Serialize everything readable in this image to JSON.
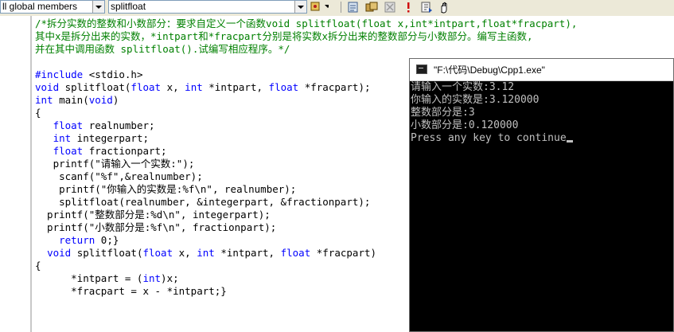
{
  "toolbar": {
    "members_combo": "ll global members",
    "function_combo": "splitfloat",
    "icons": [
      "class-wizard-icon",
      "add-member-icon",
      "toggle-icon",
      "build-stop-icon",
      "build-icon",
      "go-icon",
      "breakpoint-icon"
    ]
  },
  "editor": {
    "lines": [
      [
        {
          "t": "/*拆分实数的整数和小数部分：要求自定义一个函数void splitfloat(float x,int*intpart,float*fracpart),",
          "c": "cmt"
        }
      ],
      [
        {
          "t": "其中x是拆分出来的实数，*intpart和*fracpart分别是将实数x拆分出来的整数部分与小数部分。编写主函数,",
          "c": "cmt"
        }
      ],
      [
        {
          "t": "并在其中调用函数 splitfloat().试编写相应程序。*/",
          "c": "cmt"
        }
      ],
      [
        {
          "t": "",
          "c": ""
        }
      ],
      [
        {
          "t": "#include",
          "c": "pp"
        },
        {
          "t": " <stdio.h>",
          "c": ""
        }
      ],
      [
        {
          "t": "void",
          "c": "kw"
        },
        {
          "t": " splitfloat(",
          "c": ""
        },
        {
          "t": "float",
          "c": "kw"
        },
        {
          "t": " x, ",
          "c": ""
        },
        {
          "t": "int",
          "c": "kw"
        },
        {
          "t": " *intpart, ",
          "c": ""
        },
        {
          "t": "float",
          "c": "kw"
        },
        {
          "t": " *fracpart);",
          "c": ""
        }
      ],
      [
        {
          "t": "int",
          "c": "kw"
        },
        {
          "t": " main(",
          "c": ""
        },
        {
          "t": "void",
          "c": "kw"
        },
        {
          "t": ")",
          "c": ""
        }
      ],
      [
        {
          "t": "{",
          "c": ""
        }
      ],
      [
        {
          "t": "   ",
          "c": ""
        },
        {
          "t": "float",
          "c": "kw"
        },
        {
          "t": " realnumber;",
          "c": ""
        }
      ],
      [
        {
          "t": "   ",
          "c": ""
        },
        {
          "t": "int",
          "c": "kw"
        },
        {
          "t": " integerpart;",
          "c": ""
        }
      ],
      [
        {
          "t": "   ",
          "c": ""
        },
        {
          "t": "float",
          "c": "kw"
        },
        {
          "t": " fractionpart;",
          "c": ""
        }
      ],
      [
        {
          "t": "   printf(\"请输入一个实数:\");",
          "c": ""
        }
      ],
      [
        {
          "t": "    scanf(\"%f\",&realnumber);",
          "c": ""
        }
      ],
      [
        {
          "t": "    printf(\"你输入的实数是:%f\\n\", realnumber);",
          "c": ""
        }
      ],
      [
        {
          "t": "    splitfloat(realnumber, &integerpart, &fractionpart);",
          "c": ""
        }
      ],
      [
        {
          "t": "  printf(\"整数部分是:%d\\n\", integerpart);",
          "c": ""
        }
      ],
      [
        {
          "t": "  printf(\"小数部分是:%f\\n\", fractionpart);",
          "c": ""
        }
      ],
      [
        {
          "t": "    ",
          "c": ""
        },
        {
          "t": "return",
          "c": "kw"
        },
        {
          "t": " 0;}",
          "c": ""
        }
      ],
      [
        {
          "t": "  ",
          "c": ""
        },
        {
          "t": "void",
          "c": "kw"
        },
        {
          "t": " splitfloat(",
          "c": ""
        },
        {
          "t": "float",
          "c": "kw"
        },
        {
          "t": " x, ",
          "c": ""
        },
        {
          "t": "int",
          "c": "kw"
        },
        {
          "t": " *intpart, ",
          "c": ""
        },
        {
          "t": "float",
          "c": "kw"
        },
        {
          "t": " *fracpart)",
          "c": ""
        }
      ],
      [
        {
          "t": "{",
          "c": ""
        }
      ],
      [
        {
          "t": "      *intpart = (",
          "c": ""
        },
        {
          "t": "int",
          "c": "kw"
        },
        {
          "t": ")x;",
          "c": ""
        }
      ],
      [
        {
          "t": "      *fracpart = x - *intpart;}",
          "c": ""
        }
      ]
    ]
  },
  "console": {
    "title": "\"F:\\代码\\Debug\\Cpp1.exe\"",
    "lines": [
      "请输入一个实数:3.12",
      "你输入的实数是:3.120000",
      "整数部分是:3",
      "小数部分是:0.120000",
      "Press any key to continue"
    ]
  }
}
